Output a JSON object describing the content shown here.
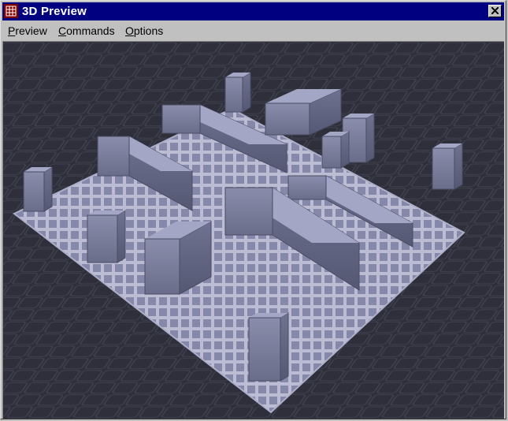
{
  "window": {
    "title": "3D Preview",
    "app_icon": "app-grid-icon",
    "close_icon": "close-icon"
  },
  "menu": {
    "items": [
      {
        "label_first": "P",
        "label_rest": "review"
      },
      {
        "label_first": "C",
        "label_rest": "ommands"
      },
      {
        "label_first": "O",
        "label_rest": "ptions"
      }
    ]
  },
  "viewport": {
    "scene": "3d-maze-preview",
    "background_color": "#2a2b35",
    "floor_color": "#9a9cc0",
    "wall_color": "#7c7f9c"
  }
}
